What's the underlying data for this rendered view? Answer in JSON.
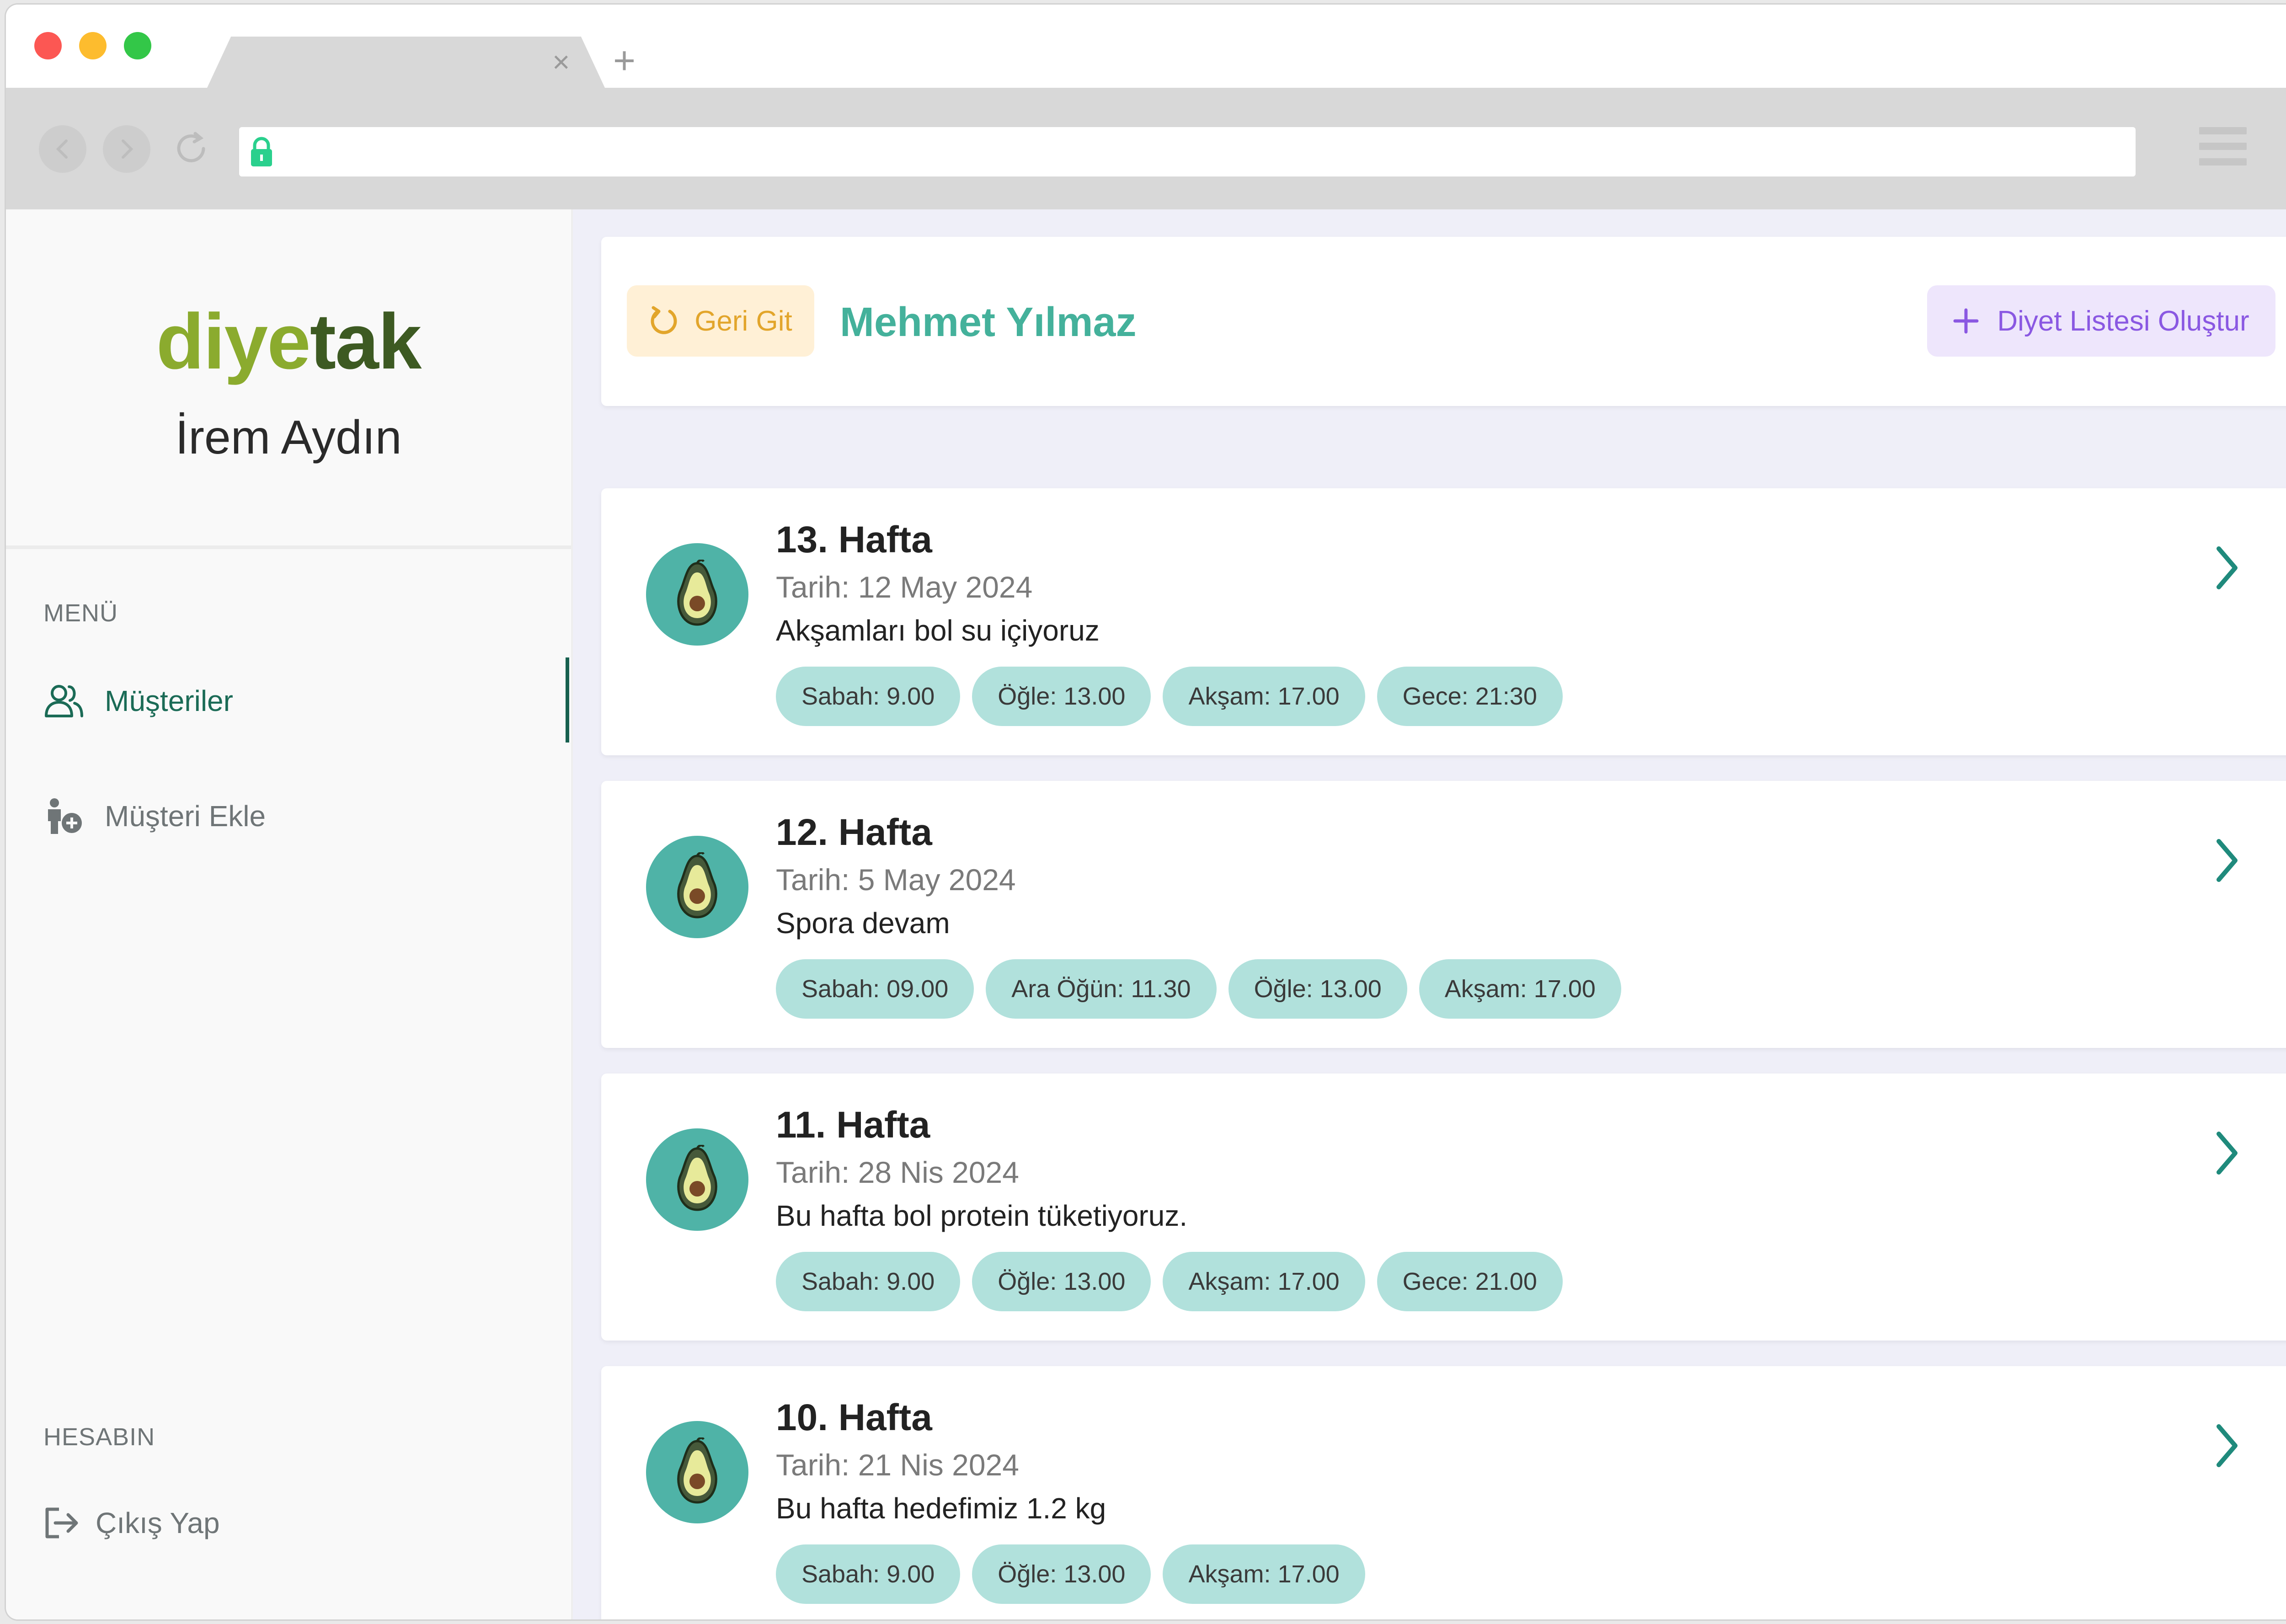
{
  "brand": {
    "logo_part1": "diye",
    "logo_part2": "tak"
  },
  "sidebar": {
    "user_name": "İrem Aydın",
    "menu_label": "MENÜ",
    "items": [
      {
        "label": "Müşteriler",
        "icon": "users-icon",
        "active": true
      },
      {
        "label": "Müşteri Ekle",
        "icon": "add-user-icon",
        "active": false
      }
    ],
    "account_label": "HESABIN",
    "logout_label": "Çıkış Yap"
  },
  "header": {
    "back_label": "Geri Git",
    "client_name": "Mehmet Yılmaz",
    "create_label": "Diyet Listesi Oluştur"
  },
  "weeks": [
    {
      "title": "13. Hafta",
      "date": "Tarih: 12 May 2024",
      "note": "Akşamları bol su içiyoruz",
      "meals": [
        "Sabah: 9.00",
        "Öğle: 13.00",
        "Akşam: 17.00",
        "Gece: 21:30"
      ]
    },
    {
      "title": "12. Hafta",
      "date": "Tarih: 5 May 2024",
      "note": "Spora devam",
      "meals": [
        "Sabah: 09.00",
        "Ara Öğün: 11.30",
        "Öğle: 13.00",
        "Akşam: 17.00"
      ]
    },
    {
      "title": "11. Hafta",
      "date": "Tarih: 28 Nis 2024",
      "note": "Bu hafta bol protein tüketiyoruz.",
      "meals": [
        "Sabah: 9.00",
        "Öğle: 13.00",
        "Akşam: 17.00",
        "Gece: 21.00"
      ]
    },
    {
      "title": "10. Hafta",
      "date": "Tarih: 21 Nis 2024",
      "note": "Bu hafta hedefimiz 1.2 kg",
      "meals": [
        "Sabah: 9.00",
        "Öğle: 13.00",
        "Akşam: 17.00"
      ]
    }
  ],
  "colors": {
    "primary": "#44b19b",
    "accent_dark": "#17604f",
    "back_button_bg": "#fff0d6",
    "back_button_text": "#e2a52b",
    "create_button_bg": "#eee6fc",
    "create_button_text": "#8a58e2",
    "chip_bg": "#b1e1dc"
  }
}
